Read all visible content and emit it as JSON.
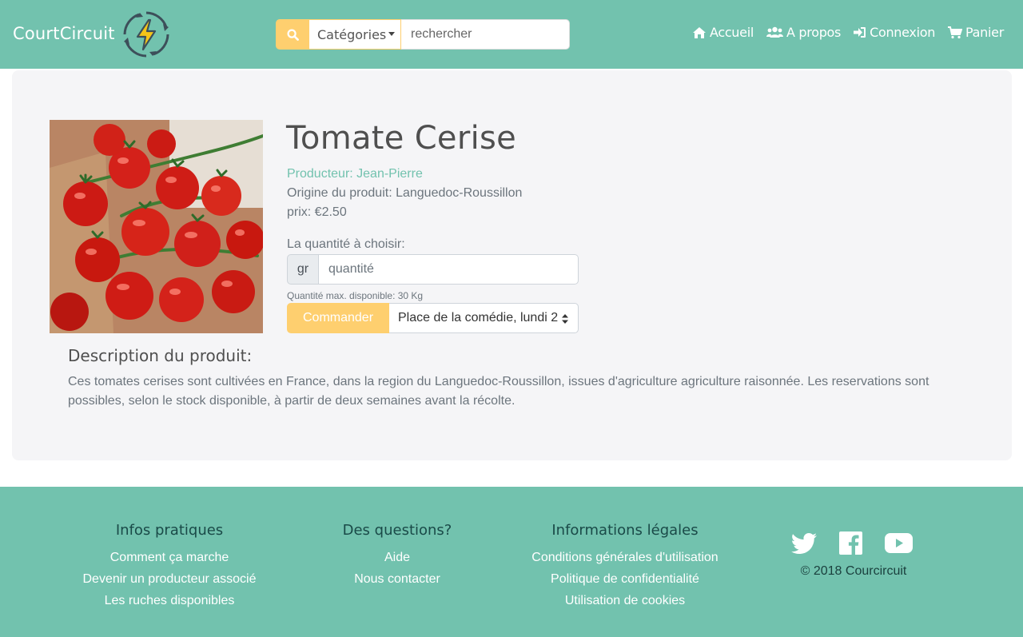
{
  "header": {
    "brand": "CourtCircuit",
    "categories_label": "Catégories",
    "search_placeholder": "rechercher",
    "nav": [
      {
        "label": "Accueil",
        "icon": "home-icon"
      },
      {
        "label": "A propos",
        "icon": "users-icon"
      },
      {
        "label": "Connexion",
        "icon": "sign-in-icon"
      },
      {
        "label": "Panier",
        "icon": "cart-icon"
      }
    ]
  },
  "product": {
    "title": "Tomate Cerise",
    "producer": "Producteur: Jean-Pierre",
    "origin": "Origine du produit: Languedoc-Roussillon",
    "price": "prix: €2.50",
    "quantity_label": "La quantité à choisir:",
    "unit": "gr",
    "quantity_placeholder": "quantité",
    "max_quantity": "Quantité max. disponible: 30 Kg",
    "order_button": "Commander",
    "pickup_selected": "Place de la comédie, lundi 2",
    "description_title": "Description du produit:",
    "description": "Ces tomates cerises sont cultivées en France, dans la region du Languedoc-Roussillon, issues d'agriculture agriculture raisonnée. Les reservations sont possibles, selon le stock disponible, à partir de deux semaines avant la récolte."
  },
  "footer": {
    "columns": [
      {
        "title": "Infos pratiques",
        "links": [
          "Comment ça marche",
          "Devenir un producteur associé",
          "Les ruches disponibles"
        ]
      },
      {
        "title": "Des questions?",
        "links": [
          "Aide",
          "Nous contacter"
        ]
      },
      {
        "title": "Informations légales",
        "links": [
          "Conditions générales d'utilisation",
          "Politique de confidentialité",
          "Utilisation de cookies"
        ]
      }
    ],
    "copyright": "© 2018 Courcircuit"
  },
  "colors": {
    "primary": "#72c2ae",
    "accent": "#fecf6f",
    "panel": "#f5f5f7"
  }
}
